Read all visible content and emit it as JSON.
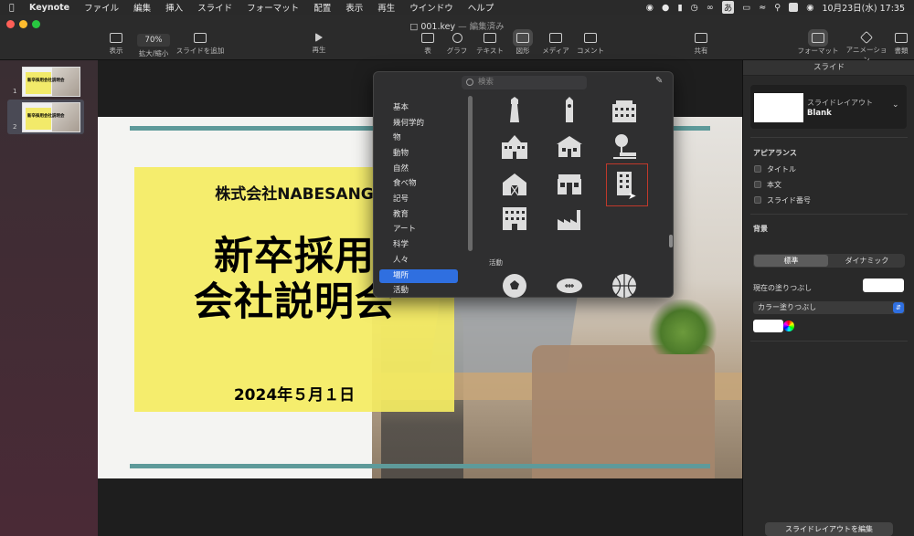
{
  "menubar": {
    "app_name": "Keynote",
    "items": [
      "ファイル",
      "編集",
      "挿入",
      "スライド",
      "フォーマット",
      "配置",
      "表示",
      "再生",
      "ウインドウ",
      "ヘルプ"
    ],
    "ime": "あ",
    "datetime": "10月23日(水) 17:35"
  },
  "window": {
    "title": "001.key",
    "title_status": "— 編集済み"
  },
  "toolbar": {
    "view": "表示",
    "zoom_value": "70%",
    "zoom_label": "拡大/縮小",
    "add_slide": "スライドを追加",
    "play": "再生",
    "table": "表",
    "chart": "グラフ",
    "text": "テキスト",
    "shape": "図形",
    "media": "メディア",
    "comment": "コメント",
    "share": "共有",
    "format": "フォーマット",
    "animate": "アニメーション",
    "document": "書類"
  },
  "navigator": {
    "slides": [
      {
        "num": "1",
        "thumb_text": "新卒採用会社説明会"
      },
      {
        "num": "2",
        "thumb_text": "新卒採用会社説明会"
      }
    ]
  },
  "slide": {
    "company": "株式会社NABESANG",
    "headline_line1": "新卒採用",
    "headline_line2": "会社説明会",
    "date": "2024年５月１日"
  },
  "shape_library": {
    "search_placeholder": "検索",
    "categories": [
      "基本",
      "幾何学的",
      "物",
      "動物",
      "自然",
      "食べ物",
      "記号",
      "教育",
      "アート",
      "科学",
      "人々",
      "場所",
      "活動"
    ],
    "selected_category": "場所",
    "section_label": "活動",
    "shapes": [
      "lighthouse-icon",
      "tower-icon",
      "office-building-icon",
      "school-icon",
      "house-icon",
      "signpost-icon",
      "barn-icon",
      "shop-icon",
      "tall-building-icon",
      "apartment-icon",
      "factory-icon"
    ],
    "activity_shapes": [
      "soccer-ball-icon",
      "football-icon",
      "basketball-icon"
    ]
  },
  "inspector": {
    "tab_title": "スライド",
    "layout_label": "スライドレイアウト",
    "layout_name": "Blank",
    "appearance_title": "アピアランス",
    "checkboxes": [
      "タイトル",
      "本文",
      "スライド番号"
    ],
    "background_title": "背景",
    "seg_standard": "標準",
    "seg_dynamic": "ダイナミック",
    "current_fill": "現在の塗りつぶし",
    "fill_type": "カラー塗りつぶし",
    "edit_layout_button": "スライドレイアウトを編集"
  },
  "colors": {
    "accent": "#2f6fe0",
    "slide_yellow": "#f4ec62",
    "teal_bar": "#5e9a9a",
    "selection_red": "#c0392b"
  }
}
